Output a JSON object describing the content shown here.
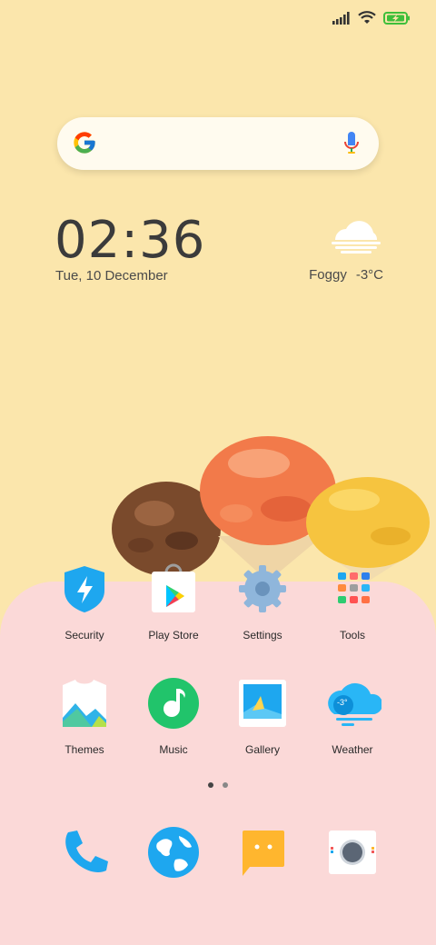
{
  "clock": {
    "time": "02:36",
    "date": "Tue, 10 December"
  },
  "weather": {
    "condition": "Foggy",
    "temperature": "-3°C"
  },
  "search": {
    "placeholder": ""
  },
  "apps_row1": [
    {
      "label": "Security"
    },
    {
      "label": "Play Store"
    },
    {
      "label": "Settings"
    },
    {
      "label": "Tools"
    }
  ],
  "apps_row2": [
    {
      "label": "Themes"
    },
    {
      "label": "Music"
    },
    {
      "label": "Gallery"
    },
    {
      "label": "Weather",
      "badge": "-3°"
    }
  ],
  "page_indicator": {
    "pages": 2,
    "current": 1
  },
  "colors": {
    "wallpaper": "#fbe6ac",
    "panel": "#fbd9d8",
    "battery": "#3fbf3a"
  }
}
